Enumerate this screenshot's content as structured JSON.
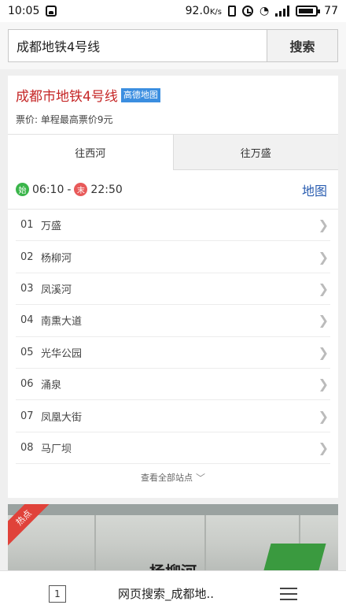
{
  "status_bar": {
    "time": "10:05",
    "speed": "92.0",
    "speed_unit": "K/s",
    "battery": "77"
  },
  "search": {
    "query": "成都地铁4号线",
    "button_label": "搜索"
  },
  "line_card": {
    "title": "成都市地铁4号线",
    "map_tag": "高德地图",
    "fare": "票价: 单程最高票价9元",
    "tabs": [
      {
        "label": "往西河",
        "active": true
      },
      {
        "label": "往万盛",
        "active": false
      }
    ],
    "first_badge": "始",
    "first_time": "06:10",
    "separator": "-",
    "last_badge": "末",
    "last_time": "22:50",
    "map_link": "地图",
    "stations": [
      {
        "num": "01",
        "name": "万盛"
      },
      {
        "num": "02",
        "name": "杨柳河"
      },
      {
        "num": "03",
        "name": "凤溪河"
      },
      {
        "num": "04",
        "name": "南熏大道"
      },
      {
        "num": "05",
        "name": "光华公园"
      },
      {
        "num": "06",
        "name": "涌泉"
      },
      {
        "num": "07",
        "name": "凤凰大街"
      },
      {
        "num": "08",
        "name": "马厂坝"
      }
    ],
    "view_all": "查看全部站点"
  },
  "photo_card": {
    "badge": "热点",
    "sign_text": "杨柳河"
  },
  "bottom_bar": {
    "tab_count": "1",
    "page_title": "网页搜索_成都地.."
  },
  "colors": {
    "title_red": "#c52626",
    "map_tag_blue": "#3b8ee0",
    "start_green": "#3ab54a",
    "end_red": "#e85a5a",
    "link_blue": "#2a5db0"
  }
}
